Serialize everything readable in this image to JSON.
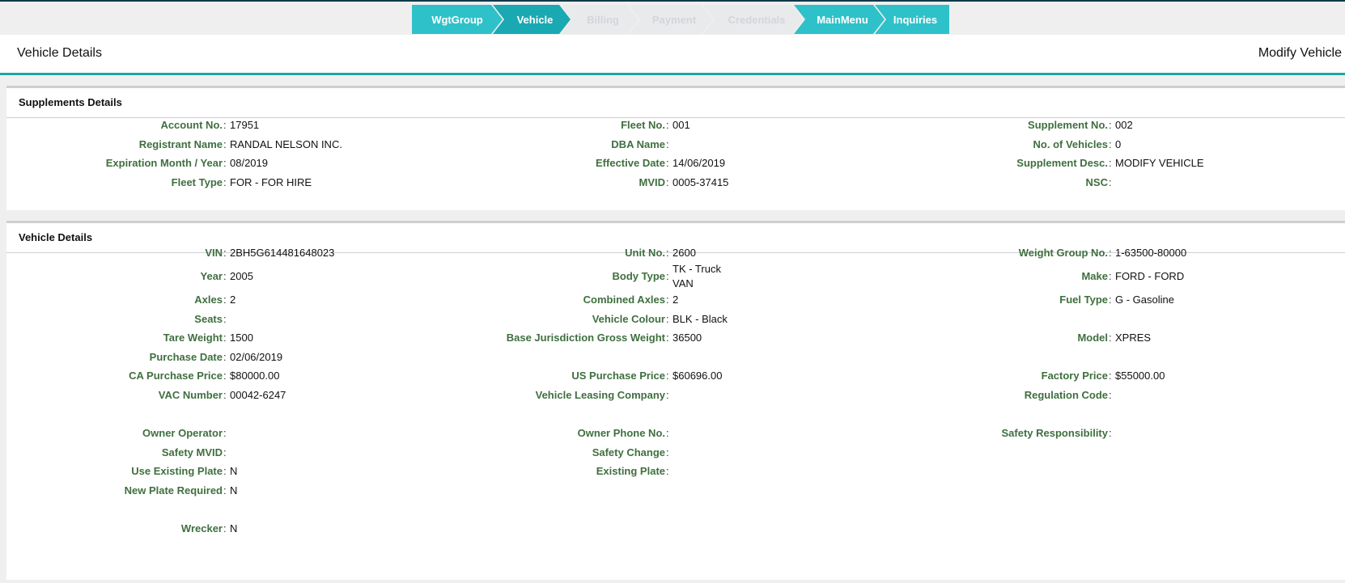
{
  "wizard": {
    "steps": [
      {
        "label": "WgtGroup"
      },
      {
        "label": "Vehicle"
      },
      {
        "label": "Billing"
      },
      {
        "label": "Payment"
      },
      {
        "label": "Credentials"
      },
      {
        "label": "MainMenu"
      },
      {
        "label": "Inquiries"
      }
    ]
  },
  "header": {
    "title": "Vehicle Details",
    "action": "Modify Vehicle"
  },
  "supplements": {
    "title": "Supplements Details",
    "fields": {
      "account_no": {
        "label": "Account No.",
        "value": "17951"
      },
      "fleet_no": {
        "label": "Fleet No.",
        "value": "001"
      },
      "supplement_no": {
        "label": "Supplement No.",
        "value": "002"
      },
      "registrant_name": {
        "label": "Registrant Name",
        "value": "RANDAL NELSON INC."
      },
      "dba_name": {
        "label": "DBA Name",
        "value": ""
      },
      "no_of_vehicles": {
        "label": "No. of Vehicles",
        "value": "0"
      },
      "expiration": {
        "label": "Expiration Month / Year",
        "value": "08/2019"
      },
      "effective_date": {
        "label": "Effective Date",
        "value": "14/06/2019"
      },
      "supplement_desc": {
        "label": "Supplement Desc.",
        "value": "MODIFY VEHICLE"
      },
      "fleet_type": {
        "label": "Fleet Type",
        "value": "FOR - FOR HIRE"
      },
      "mvid": {
        "label": "MVID",
        "value": "0005-37415"
      },
      "nsc": {
        "label": "NSC",
        "value": ""
      }
    }
  },
  "vehicle": {
    "title": "Vehicle Details",
    "fields": {
      "vin": {
        "label": "VIN",
        "value": "2BH5G614481648023"
      },
      "unit_no": {
        "label": "Unit No.",
        "value": "2600"
      },
      "weight_group_no": {
        "label": "Weight Group No.",
        "value": "1-63500-80000"
      },
      "year": {
        "label": "Year",
        "value": "2005"
      },
      "body_type": {
        "label": "Body Type",
        "value_line1": "TK - Truck",
        "value_line2": "VAN"
      },
      "make": {
        "label": "Make",
        "value": "FORD - FORD"
      },
      "axles": {
        "label": "Axles",
        "value": "2"
      },
      "combined_axles": {
        "label": "Combined Axles",
        "value": "2"
      },
      "fuel_type": {
        "label": "Fuel Type",
        "value": "G - Gasoline"
      },
      "seats": {
        "label": "Seats",
        "value": ""
      },
      "vehicle_colour": {
        "label": "Vehicle Colour",
        "value": "BLK - Black"
      },
      "tare_weight": {
        "label": "Tare Weight",
        "value": "1500"
      },
      "base_jurisdiction": {
        "label": "Base Jurisdiction Gross Weight",
        "value": "36500"
      },
      "model": {
        "label": "Model",
        "value": "XPRES"
      },
      "purchase_date": {
        "label": "Purchase Date",
        "value": "02/06/2019"
      },
      "ca_purchase_price": {
        "label": "CA Purchase Price",
        "value": "$80000.00"
      },
      "us_purchase_price": {
        "label": "US Purchase Price",
        "value": "$60696.00"
      },
      "factory_price": {
        "label": "Factory Price",
        "value": "$55000.00"
      },
      "vac_number": {
        "label": "VAC Number",
        "value": "00042-6247"
      },
      "leasing_company": {
        "label": "Vehicle Leasing Company",
        "value": ""
      },
      "regulation_code": {
        "label": "Regulation Code",
        "value": ""
      },
      "owner_operator": {
        "label": "Owner Operator",
        "value": ""
      },
      "owner_phone": {
        "label": "Owner Phone No.",
        "value": ""
      },
      "safety_responsibility": {
        "label": "Safety Responsibility",
        "value": ""
      },
      "safety_mvid": {
        "label": "Safety MVID",
        "value": ""
      },
      "safety_change": {
        "label": "Safety Change",
        "value": ""
      },
      "use_existing_plate": {
        "label": "Use Existing Plate",
        "value": "N"
      },
      "existing_plate": {
        "label": "Existing Plate",
        "value": ""
      },
      "new_plate_required": {
        "label": "New Plate Required",
        "value": "N"
      },
      "wrecker": {
        "label": "Wrecker",
        "value": "N"
      }
    }
  },
  "separator": ":"
}
